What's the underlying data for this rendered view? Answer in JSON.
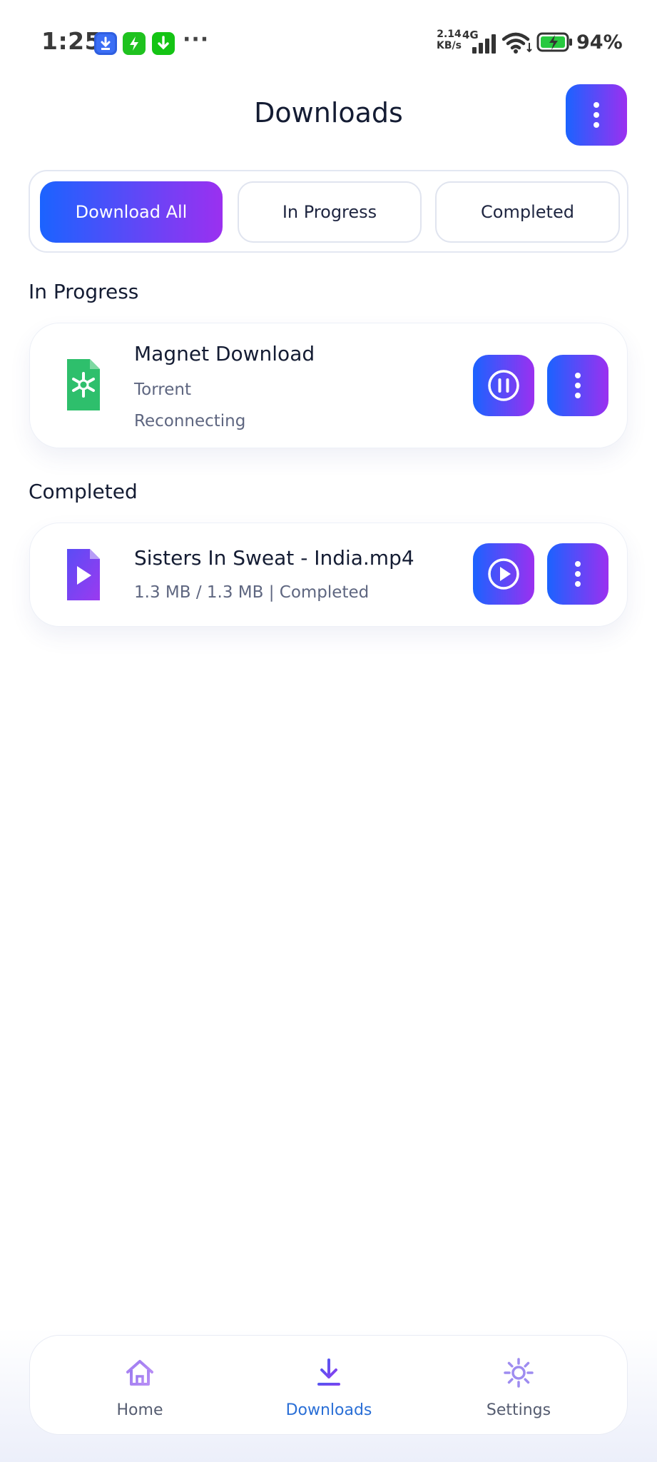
{
  "status_bar": {
    "time": "1:25",
    "more": "···",
    "speed_value": "2.14",
    "speed_unit": "KB/s",
    "network": "4G",
    "battery": "94%"
  },
  "header": {
    "title": "Downloads",
    "menu_icon": "more-vertical-icon"
  },
  "filters": {
    "tabs": [
      {
        "label": "Download All",
        "active": true
      },
      {
        "label": "In Progress",
        "active": false
      },
      {
        "label": "Completed",
        "active": false
      }
    ]
  },
  "in_progress": {
    "section_title": "In Progress",
    "items": [
      {
        "title": "Magnet Download",
        "type": "Torrent",
        "status": "Reconnecting",
        "icon": "torrent-file-icon",
        "action_icon": "pause-icon"
      }
    ]
  },
  "completed": {
    "section_title": "Completed",
    "items": [
      {
        "title": "Sisters In Sweat - India.mp4",
        "details": "1.3 MB / 1.3 MB | Completed",
        "icon": "video-file-icon",
        "action_icon": "play-icon"
      }
    ]
  },
  "bottom_nav": {
    "items": [
      {
        "label": "Home",
        "icon": "home-icon",
        "active": false
      },
      {
        "label": "Downloads",
        "icon": "download-icon",
        "active": true
      },
      {
        "label": "Settings",
        "icon": "settings-icon",
        "active": false
      }
    ]
  },
  "colors": {
    "gradient_start": "#1b63ff",
    "gradient_end": "#9b30f0",
    "active_nav": "#2a6fd6",
    "torrent_green": "#2ebf6c",
    "video_purple": "#7b3cf0"
  }
}
